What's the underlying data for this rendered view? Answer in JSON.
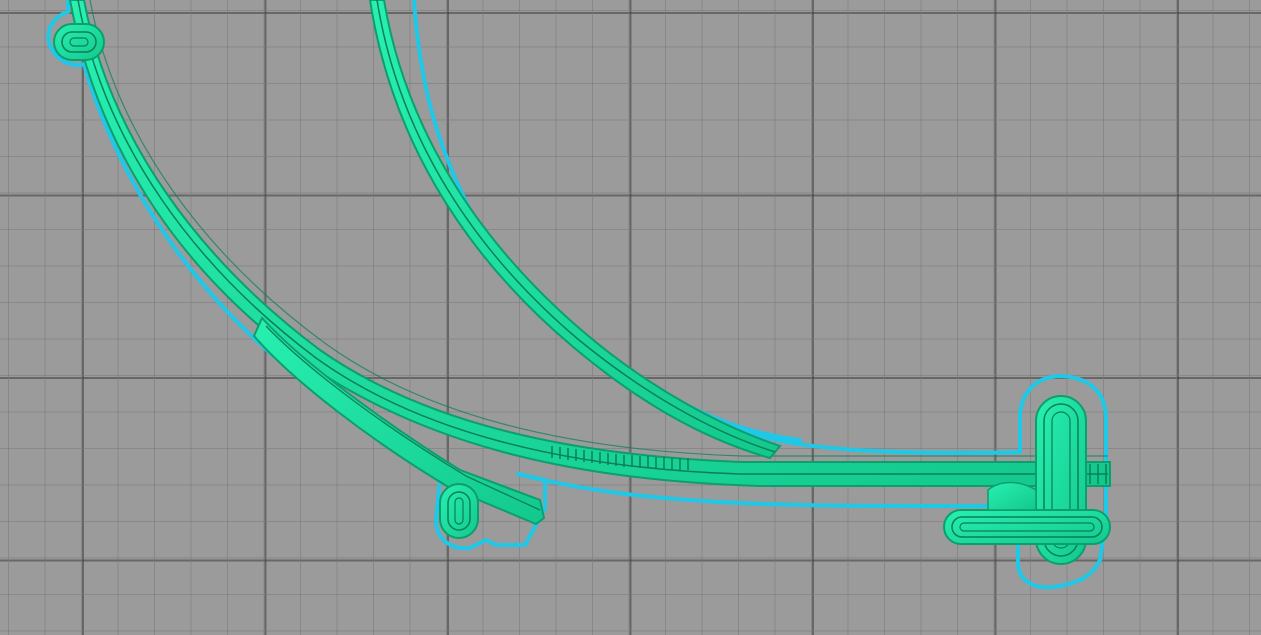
{
  "scene": {
    "view": "slicer-layer-preview",
    "bed_grid": "visible",
    "colors": {
      "bed": "#9b9b9b",
      "grid_minor": "#7f7f7f",
      "grid_major": "#5e5e5e",
      "skirt": "#1ec8e6",
      "perimeter": "#1fe6a6",
      "perimeter_shade": "#0d9e6e"
    },
    "objects": [
      "skirt-outline",
      "outer-arc-band",
      "inner-arc-band",
      "left-tab",
      "mid-tab",
      "right-tab"
    ]
  }
}
